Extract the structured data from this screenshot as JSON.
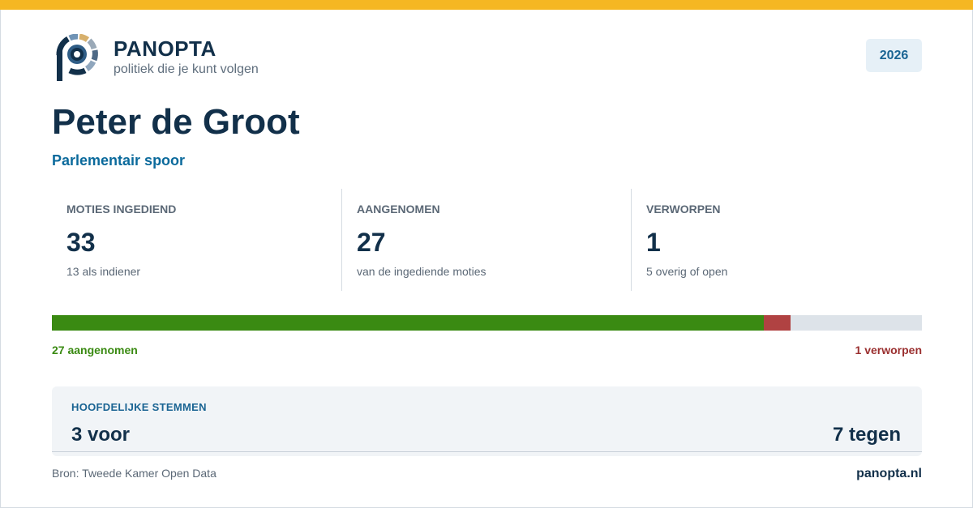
{
  "brand": {
    "name": "PANOPTA",
    "tagline": "politiek die je kunt volgen",
    "colors": {
      "accent": "#f5b722",
      "navy": "#12304a",
      "blue": "#0b6a9c"
    }
  },
  "year": "2026",
  "person": {
    "name": "Peter de Groot",
    "subtitle": "Parlementair spoor"
  },
  "stats": [
    {
      "label": "MOTIES INGEDIEND",
      "value": "33",
      "note": "13 als indiener"
    },
    {
      "label": "AANGENOMEN",
      "value": "27",
      "note": "van de ingediende moties"
    },
    {
      "label": "VERWORPEN",
      "value": "1",
      "note": "5 overig of open"
    }
  ],
  "progress": {
    "total": 33,
    "adopted": 27,
    "rejected": 1,
    "adopted_label": "27 aangenomen",
    "rejected_label": "1 verworpen",
    "colors": {
      "adopted": "#3a8a12",
      "rejected": "#b04242",
      "rest": "#dde3e9"
    }
  },
  "votes": {
    "title": "HOOFDELIJKE STEMMEN",
    "for_label": "3 voor",
    "against_label": "7 tegen"
  },
  "footer": {
    "source": "Bron: Tweede Kamer Open Data",
    "site": "panopta.nl"
  }
}
